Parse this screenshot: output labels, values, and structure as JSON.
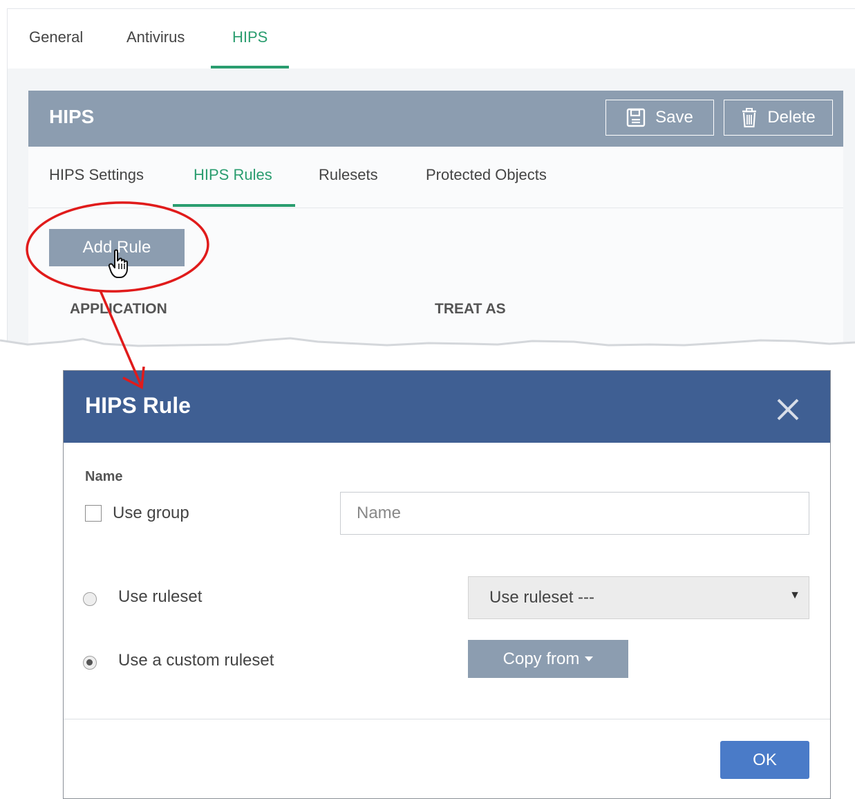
{
  "top_tabs": {
    "items": [
      {
        "label": "General"
      },
      {
        "label": "Antivirus"
      },
      {
        "label": "HIPS"
      }
    ],
    "active": "HIPS"
  },
  "hips_panel": {
    "title": "HIPS",
    "save_label": "Save",
    "delete_label": "Delete",
    "sub_tabs": [
      {
        "label": "HIPS Settings"
      },
      {
        "label": "HIPS Rules"
      },
      {
        "label": "Rulesets"
      },
      {
        "label": "Protected Objects"
      }
    ],
    "active_sub_tab": "HIPS Rules",
    "add_rule_label": "Add Rule",
    "columns": [
      "APPLICATION",
      "TREAT AS"
    ]
  },
  "dialog": {
    "title": "HIPS Rule",
    "name_label": "Name",
    "use_group_label": "Use group",
    "use_group_checked": false,
    "name_placeholder": "Name",
    "ruleset_option_label": "Use ruleset",
    "custom_ruleset_option_label": "Use a custom ruleset",
    "selected_option": "Use a custom ruleset",
    "ruleset_select_value": "Use ruleset ---",
    "copy_from_label": "Copy from",
    "ok_label": "OK"
  },
  "icons": [
    "save-icon",
    "trash-icon",
    "close-icon",
    "hand-cursor-icon",
    "chevron-down-icon"
  ],
  "colors": {
    "accent_green": "#2a9d6f",
    "panel_gray": "#8c9db0",
    "dialog_header": "#3f5f93",
    "ok_button": "#4a7bc8",
    "annotation_red": "#e01b1b"
  }
}
